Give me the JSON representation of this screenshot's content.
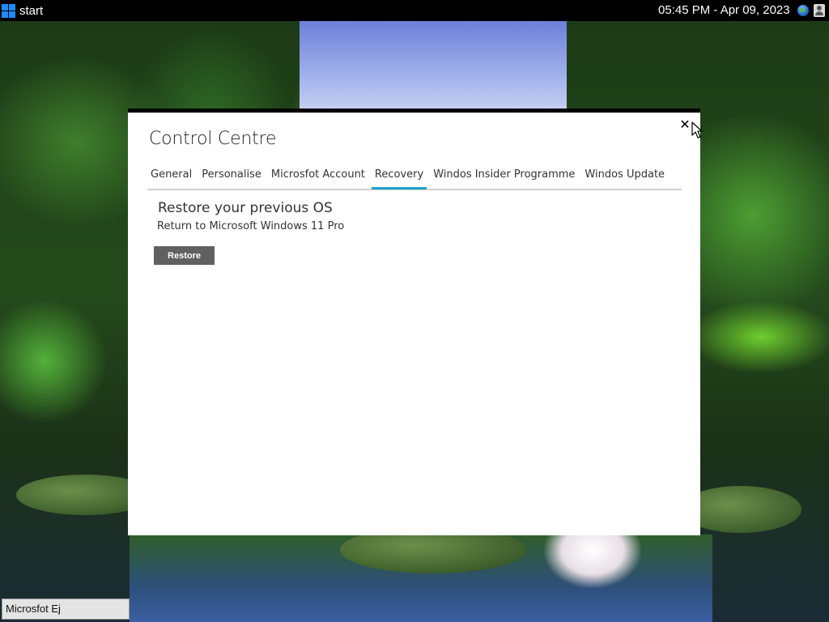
{
  "taskbar": {
    "start_label": "start",
    "clock": "05:45 PM - Apr 09, 2023",
    "globe_icon": "globe-icon",
    "user_icon": "user-icon"
  },
  "window": {
    "title": "Control Centre",
    "close_symbol": "✕",
    "tabs": [
      {
        "label": "General",
        "active": false
      },
      {
        "label": "Personalise",
        "active": false
      },
      {
        "label": "Microsfot Account",
        "active": false
      },
      {
        "label": "Recovery",
        "active": true
      },
      {
        "label": "Windos Insider Programme",
        "active": false
      },
      {
        "label": "Windos Update",
        "active": false
      }
    ],
    "section": {
      "title": "Restore your previous OS",
      "subtitle": "Return to Microsoft Windows 11 Pro",
      "restore_label": "Restore"
    }
  },
  "task_item": {
    "label": "Microsfot Ej"
  },
  "colors": {
    "accent": "#1fa3c7",
    "button_bg": "#606060",
    "taskbar_bg": "#000000",
    "start_logo": "#1e8cff"
  }
}
